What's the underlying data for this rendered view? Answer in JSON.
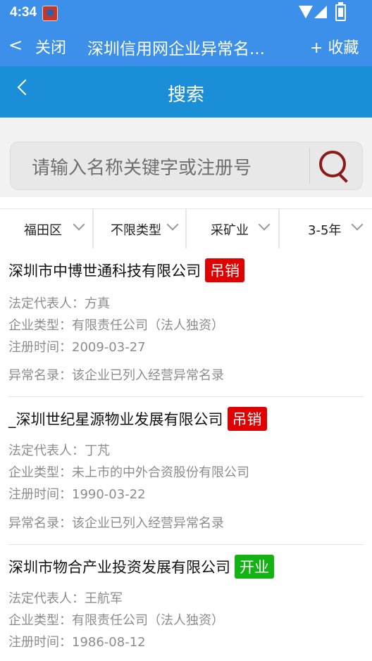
{
  "status_bar": {
    "time": "4:34"
  },
  "app_bar": {
    "back_glyph": "<",
    "close_label": "关闭",
    "title": "深圳信用网企业异常名...",
    "favorite_label": "+ 收藏"
  },
  "page_bar": {
    "title": "搜索"
  },
  "search": {
    "placeholder": "请输入名称关键字或注册号"
  },
  "filters": [
    "福田区",
    "不限类型",
    "采矿业",
    "3-5年"
  ],
  "colors": {
    "revoked": "#e00000",
    "open": "#12b312",
    "primary": "#3d90ea",
    "header": "#1a8fd8"
  },
  "results": [
    {
      "name": "深圳市中博世通科技有限公司",
      "status": "吊销",
      "rep": "法定代表人：方真",
      "type": "企业类型：有限责任公司（法人独资）",
      "reg": "注册时间：2009-03-27",
      "abnormal": "异常名录：该企业已列入经营异常名录"
    },
    {
      "name": "_深圳世纪星源物业发展有限公司",
      "status": "吊销",
      "rep": "法定代表人：丁芃",
      "type": "企业类型：未上市的中外合资股份有限公司",
      "reg": "注册时间：1990-03-22",
      "abnormal": "异常名录：该企业已列入经营异常名录"
    },
    {
      "name": "深圳市物合产业投资发展有限公司",
      "status": "开业",
      "rep": "法定代表人：王航军",
      "type": "企业类型：有限责任公司（法人独资）",
      "reg": "注册时间：1986-08-12",
      "abnormal": ""
    }
  ]
}
